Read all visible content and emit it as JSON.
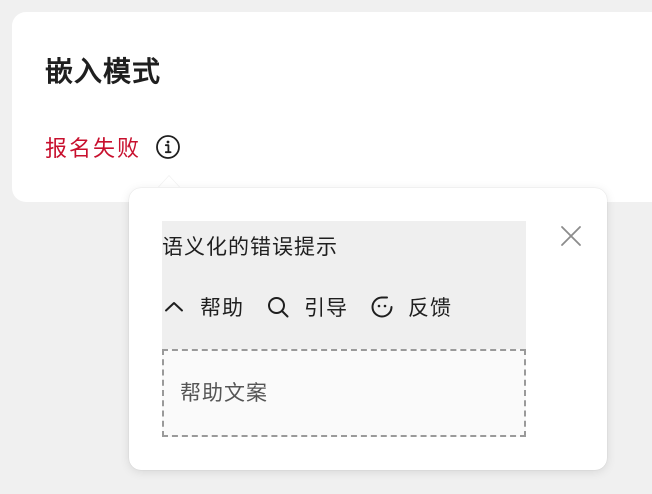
{
  "card": {
    "title": "嵌入模式",
    "status_text": "报名失败",
    "status_color": "#c8102e",
    "info_icon": "info-circle-icon"
  },
  "popover": {
    "title": "语义化的错误提示",
    "close_icon": "close-icon",
    "actions": [
      {
        "icon": "chevron-up-icon",
        "label": "帮助"
      },
      {
        "icon": "search-icon",
        "label": "引导"
      },
      {
        "icon": "feedback-face-icon",
        "label": "反馈"
      }
    ],
    "help_text": "帮助文案"
  }
}
